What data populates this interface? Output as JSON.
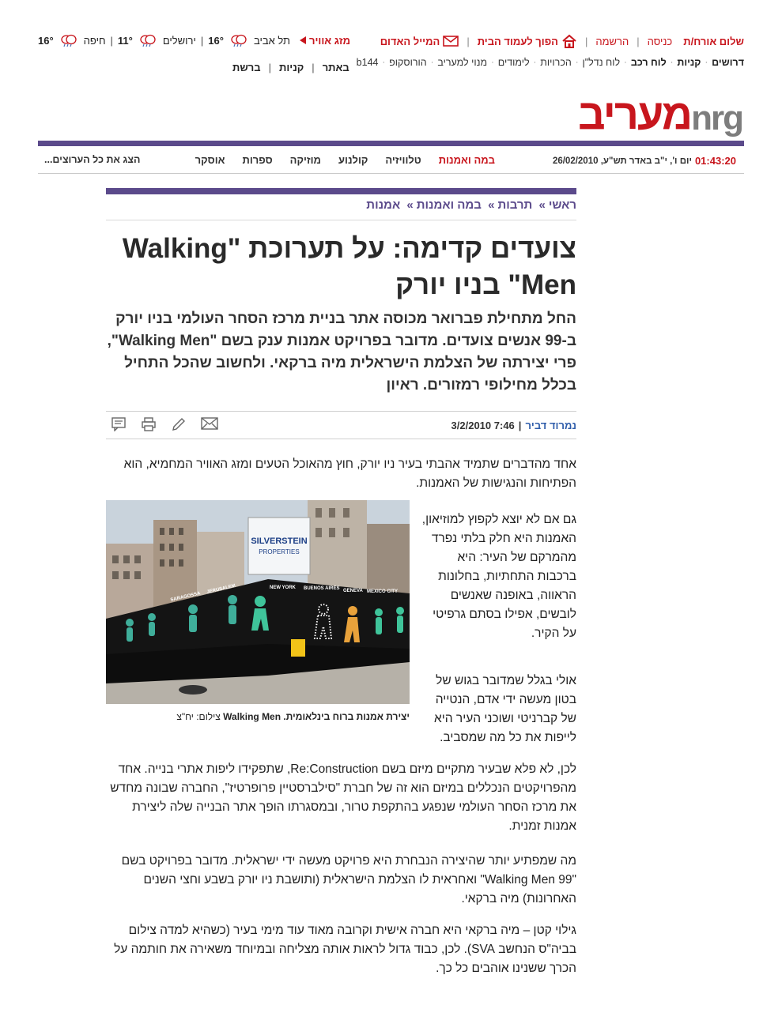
{
  "topbar": {
    "greeting": "שלום אורח/ת",
    "login": "כניסה",
    "register": "הרשמה",
    "homepage": "הפוך לעמוד הבית",
    "red_mail": "המייל האדום",
    "weather_title": "מזג אוויר",
    "cities": [
      {
        "name": "תל אביב",
        "temp": "16°"
      },
      {
        "name": "ירושלים",
        "temp": "11°"
      },
      {
        "name": "חיפה",
        "temp": "16°"
      }
    ]
  },
  "nav2": {
    "items": [
      "דרושים",
      "קניות",
      "לוח רכב",
      "לוח נדל\"ן",
      "הכרויות",
      "לימודים",
      "מנוי למעריב",
      "הורוסקופ",
      "b144"
    ],
    "left": [
      "באתר",
      "קניות",
      "ברשת"
    ]
  },
  "logo": {
    "nrg": "nrg",
    "maariv": "מעריב"
  },
  "secnav": {
    "time": "01:43:20",
    "date_text": "יום ו', י\"ב באדר תש\"ע, 26/02/2010",
    "links": [
      "במה ואמנות",
      "טלוויזיה",
      "קולנוע",
      "מוזיקה",
      "ספרות",
      "אוסקר"
    ],
    "show_all": "הצג את כל הערוצים..."
  },
  "colors": {
    "brand_red": "#c8161d",
    "purple": "#5b4a8b",
    "byline_blue": "#2e5caa"
  },
  "breadcrumb": [
    "ראשי",
    "תרבות",
    "במה ואמנות",
    "אמנות"
  ],
  "article": {
    "headline": "צועדים קדימה: על תערוכת \"Walking Men\" בניו יורק",
    "subhead": "החל מתחילת פברואר מכוסה אתר בניית מרכז הסחר העולמי בניו יורק ב-99 אנשים צועדים. מדובר בפרויקט אמנות ענק בשם \"Walking Men\", פרי יצירתה של הצלמת הישראלית מיה ברקאי. ולחשוב שהכל התחיל בכלל מחילופי רמזורים. ראיון",
    "author": "נמרוד דביר",
    "date": "7:46 3/2/2010",
    "paragraphs": [
      "אחד מהדברים שתמיד אהבתי בעיר ניו יורק, חוץ מהאוכל הטעים ומזג האוויר המחמיא, הוא הפתיחות והנגישות של האמנות.",
      "גם אם לא יוצא לקפוץ למוזיאון, האמנות היא חלק בלתי נפרד מהמרקם של העיר: היא ברכבות התחתיות, בחלונות הראווה, באופנה שאנשים לובשים, אפילו בסתם גרפיטי על הקיר.",
      "אולי בגלל שמדובר בגוש של בטון מעשה ידי אדם, הנטייה של קברניטי ושוכני העיר היא לייפות את כל מה שמסביב.",
      "לכן, לא פלא שבעיר מתקיים מיזם בשם Re:Construction, שתפקידו ליפות אתרי בנייה. אחד מהפרויקטים הנכללים במיזם הוא זה של חברת \"סילברסטיין פרופרטיז\", החברה שבונה מחדש את מרכז הסחר העולמי שנפגע בהתקפת טרור, ובמסגרתו הופך אתר הבנייה שלה ליצירת אמנות זמנית.",
      "מה שמפתיע יותר שהיצירה הנבחרת היא פרויקט מעשה ידי ישראלית. מדובר בפרויקט בשם \"Walking Men 99\" ואחראית לו הצלמת הישראלית (ותושבת ניו יורק בשבע וחצי השנים האחרונות) מיה ברקאי.",
      "גילוי קטן – מיה ברקאי היא חברה אישית וקרובה מאוד עוד מימי בעיר (כשהיא למדה צילום בביה\"ס הנחשב SVA). לכן, כבוד גדול לראות אותה מצליחה ובמיוחד משאירה את חותמה על הכרך ששנינו אוהבים כל כך."
    ],
    "figure": {
      "sign": "SILVERSTEIN PROPERTIES",
      "cities_on_wall": [
        "JERUSALEM",
        "SARAGOSSA",
        "LONDON",
        "BANGKOK",
        "NEW YORK",
        "BUENOS AIRES",
        "GENEVA",
        "MEXICO CITY",
        "PARIS"
      ],
      "caption": "יצירת אמנות ברוח בינלאומית. Walking Men",
      "credit": "צילום: יח\"צ"
    }
  }
}
